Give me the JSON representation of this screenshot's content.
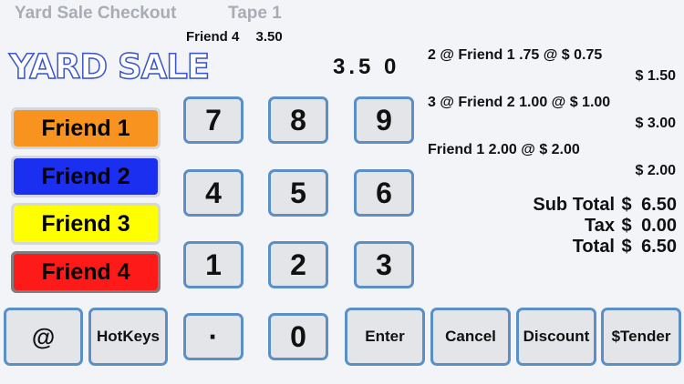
{
  "header": {
    "title": "Yard Sale Checkout",
    "tape_label": "Tape 1"
  },
  "current_line": {
    "item": "Friend 4",
    "amount": "3.50"
  },
  "logo_text": "YARD SALE",
  "display_value": "3.5 0",
  "friends": [
    {
      "label": "Friend 1",
      "color": "#f7931e",
      "active": false
    },
    {
      "label": "Friend 2",
      "color": "#1a2ff0",
      "active": false
    },
    {
      "label": "Friend 3",
      "color": "#ffff00",
      "active": false
    },
    {
      "label": "Friend 4",
      "color": "#ff1a1a",
      "active": true
    }
  ],
  "keypad": {
    "k7": "7",
    "k8": "8",
    "k9": "9",
    "k4": "4",
    "k5": "5",
    "k6": "6",
    "k1": "1",
    "k2": "2",
    "k3": "3",
    "dot": "·",
    "k0": "0"
  },
  "function_keys": {
    "at": "@",
    "hotkeys": "HotKeys",
    "enter": "Enter",
    "cancel": "Cancel",
    "discount": "Discount",
    "tender": "$Tender"
  },
  "tape": [
    {
      "desc": "2 @ Friend 1 .75 @ $ 0.75",
      "amount": "$ 1.50"
    },
    {
      "desc": "3 @ Friend 2 1.00 @ $ 1.00",
      "amount": "$ 3.00"
    },
    {
      "desc": "Friend 1 2.00 @ $ 2.00",
      "amount": "$ 2.00"
    }
  ],
  "totals": {
    "subtotal_label": "Sub Total",
    "subtotal_currency": "$",
    "subtotal_value": "6.50",
    "tax_label": "Tax",
    "tax_currency": "$",
    "tax_value": "0.00",
    "total_label": "Total",
    "total_currency": "$",
    "total_value": "6.50"
  }
}
